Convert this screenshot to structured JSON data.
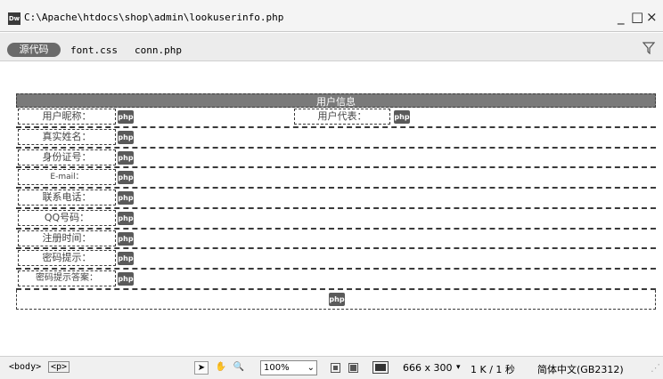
{
  "window": {
    "app_icon": "Dw",
    "title": "C:\\Apache\\htdocs\\shop\\admin\\lookuserinfo.php",
    "min_label": "_",
    "close_label": "×"
  },
  "toolbar": {
    "source_label": "源代码",
    "related_files": [
      "font.css",
      "conn.php"
    ]
  },
  "table": {
    "header": "用户信息",
    "php_tag": "php",
    "first_row": {
      "label": "用户昵称：",
      "label2": "用户代表："
    },
    "rows": [
      "真实姓名：",
      "身份证号：",
      "E-mail：",
      "联系电话：",
      "QQ号码：",
      "注册时间：",
      "密码提示：",
      "密码提示答案："
    ]
  },
  "status": {
    "tags": [
      "<body>",
      "<p>"
    ],
    "zoom": "100%",
    "window_size": "666 x 300",
    "doc_size": "1 K / 1 秒",
    "encoding": "简体中文(GB2312)"
  }
}
